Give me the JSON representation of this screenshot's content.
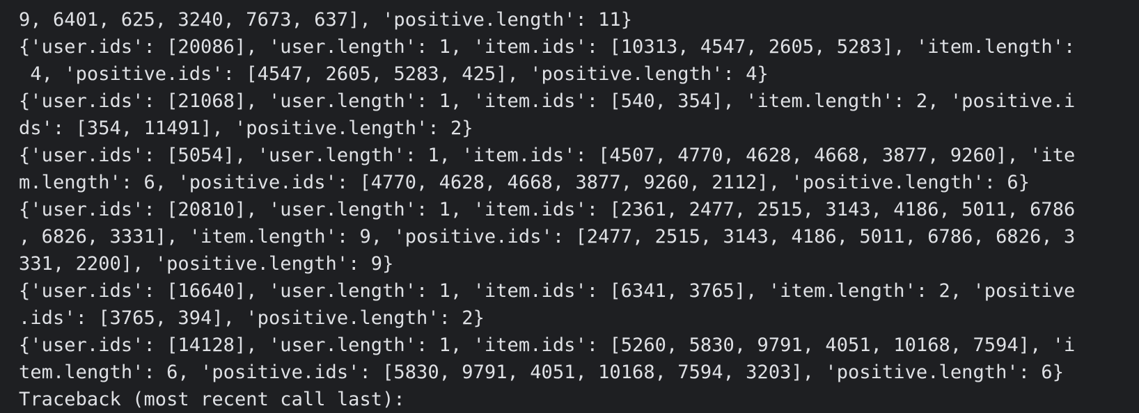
{
  "terminal": {
    "lines": [
      "9, 6401, 625, 3240, 7673, 637], 'positive.length': 11}",
      "{'user.ids': [20086], 'user.length': 1, 'item.ids': [10313, 4547, 2605, 5283], 'item.length':",
      " 4, 'positive.ids': [4547, 2605, 5283, 425], 'positive.length': 4}",
      "{'user.ids': [21068], 'user.length': 1, 'item.ids': [540, 354], 'item.length': 2, 'positive.i",
      "ds': [354, 11491], 'positive.length': 2}",
      "{'user.ids': [5054], 'user.length': 1, 'item.ids': [4507, 4770, 4628, 4668, 3877, 9260], 'ite",
      "m.length': 6, 'positive.ids': [4770, 4628, 4668, 3877, 9260, 2112], 'positive.length': 6}",
      "{'user.ids': [20810], 'user.length': 1, 'item.ids': [2361, 2477, 2515, 3143, 4186, 5011, 6786",
      ", 6826, 3331], 'item.length': 9, 'positive.ids': [2477, 2515, 3143, 4186, 5011, 6786, 6826, 3",
      "331, 2200], 'positive.length': 9}",
      "{'user.ids': [16640], 'user.length': 1, 'item.ids': [6341, 3765], 'item.length': 2, 'positive",
      ".ids': [3765, 394], 'positive.length': 2}",
      "{'user.ids': [14128], 'user.length': 1, 'item.ids': [5260, 5830, 9791, 4051, 10168, 7594], 'i",
      "tem.length': 6, 'positive.ids': [5830, 9791, 4051, 10168, 7594, 3203], 'positive.length': 6}",
      "Traceback (most recent call last):"
    ]
  },
  "colors": {
    "background": "#1e1f22",
    "text": "#dfe1e5"
  }
}
